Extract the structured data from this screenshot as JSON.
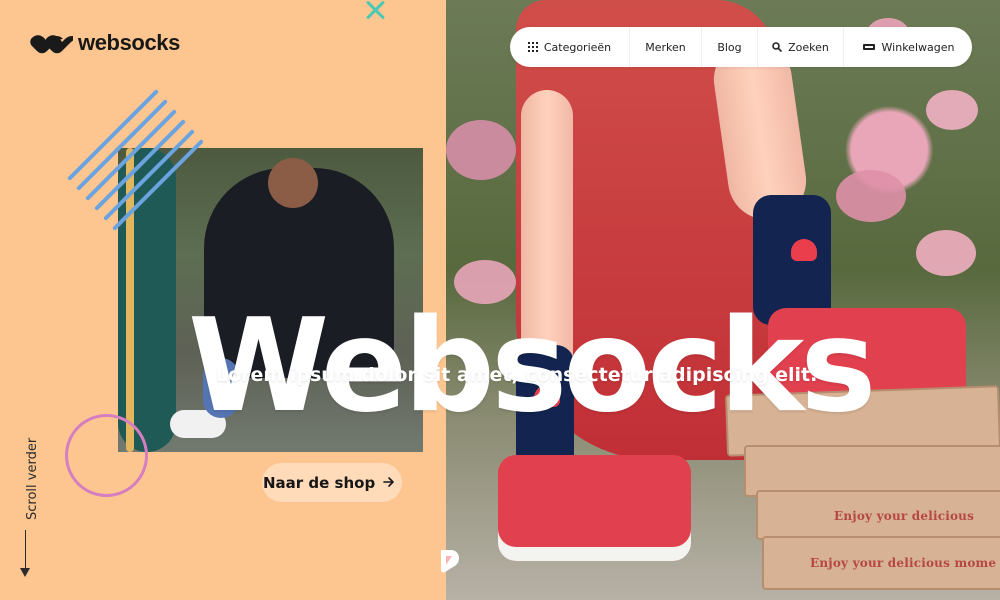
{
  "brand": {
    "logo_text": "websocks",
    "logo_icon": "websocks-logo-icon"
  },
  "navigation": {
    "items": [
      {
        "label": "Categorieën",
        "icon": "grid-icon"
      },
      {
        "label": "Merken"
      },
      {
        "label": "Blog"
      },
      {
        "label": "Zoeken",
        "icon": "search-icon"
      },
      {
        "label": "Winkelwagen",
        "icon": "cart-icon"
      }
    ]
  },
  "hero": {
    "title": "Websocks",
    "subtitle": "Lorem ipsum dolor sit amet, consectetur adipiscing elit.",
    "cta_label": "Naar de shop",
    "cta_icon": "arrow-right-icon"
  },
  "scroll": {
    "label": "Scroll verder",
    "icon": "arrow-down-icon"
  },
  "photo": {
    "box_texts": [
      "Enjoy your delicious",
      "Enjoy your delicious mome"
    ]
  },
  "colors": {
    "accent_peach": "#fdc690",
    "accent_blue": "#6aa3df",
    "accent_pink": "#d57fc1",
    "accent_teal": "#49c9b5",
    "hero_text": "#ffffff"
  }
}
